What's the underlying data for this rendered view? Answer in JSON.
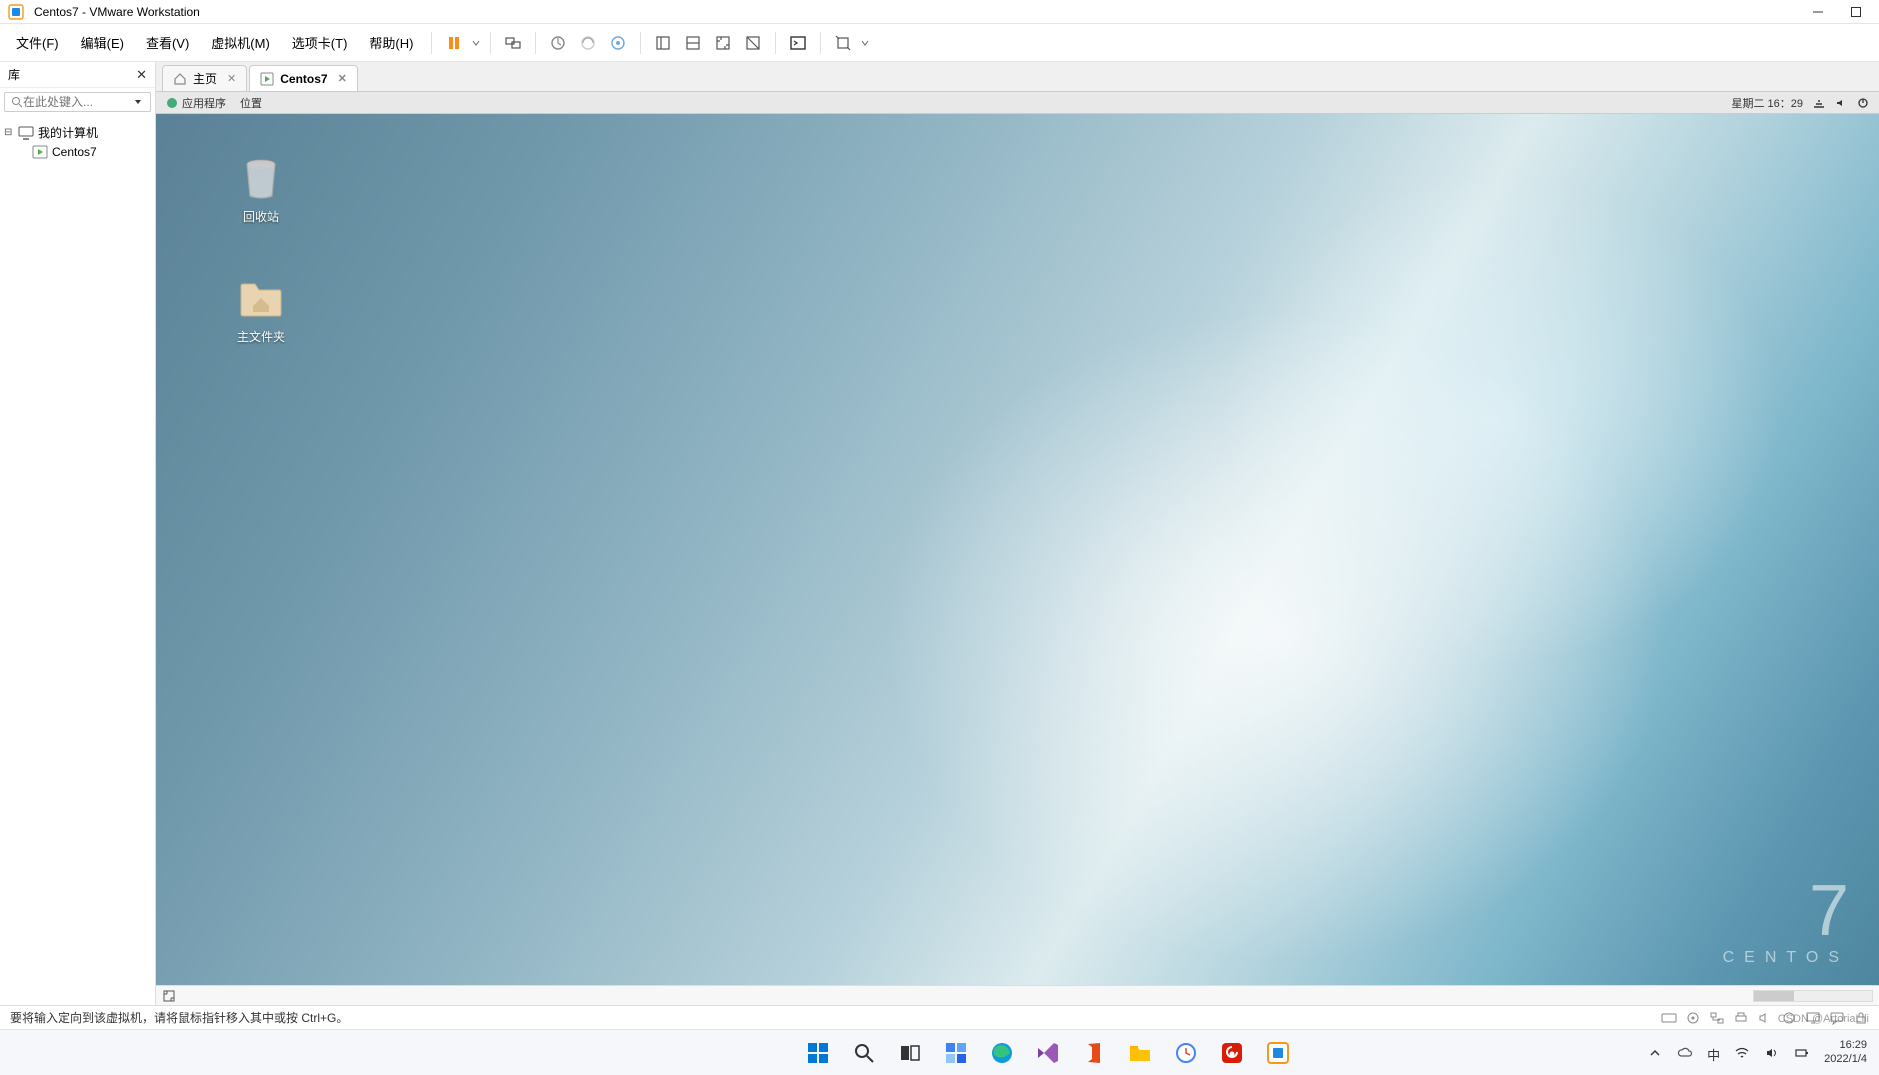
{
  "window": {
    "title": "Centos7 - VMware Workstation"
  },
  "menu": {
    "file": "文件(F)",
    "edit": "编辑(E)",
    "view": "查看(V)",
    "vm": "虚拟机(M)",
    "tabs": "选项卡(T)",
    "help": "帮助(H)"
  },
  "library": {
    "title": "库",
    "search_placeholder": "在此处键入...",
    "root": "我的计算机",
    "vm": "Centos7"
  },
  "tabs": {
    "home": "主页",
    "vm": "Centos7"
  },
  "guest_bar": {
    "apps": "应用程序",
    "location": "位置",
    "date": "星期二 16：29"
  },
  "desktop": {
    "trash": "回收站",
    "home": "主文件夹",
    "brand": "CENTOS",
    "version": "7"
  },
  "status": {
    "message": "要将输入定向到该虚拟机，请将鼠标指针移入其中或按 Ctrl+G。"
  },
  "tray": {
    "ime": "中",
    "time": "16:29",
    "date": "2022/1/4"
  },
  "watermark": "CSDN @ArtoriaLili"
}
